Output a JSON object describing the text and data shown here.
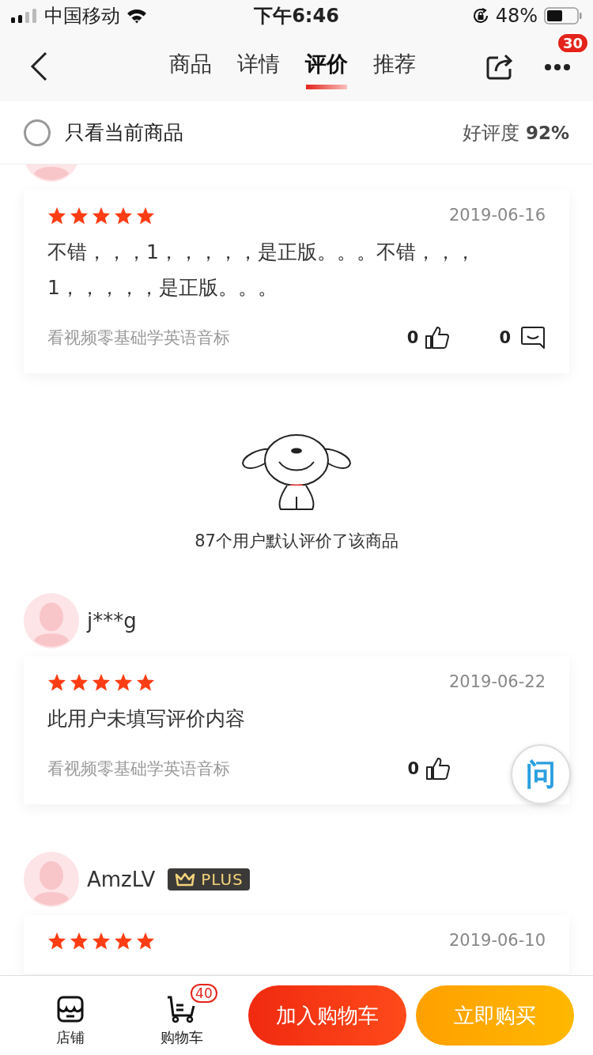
{
  "status_bar": {
    "carrier": "中国移动",
    "time": "下午6:46",
    "battery": "48%"
  },
  "nav": {
    "tabs": [
      {
        "label": "商品",
        "selected": false
      },
      {
        "label": "详情",
        "selected": false
      },
      {
        "label": "评价",
        "selected": true
      },
      {
        "label": "推荐",
        "selected": false
      }
    ],
    "more_badge": "30"
  },
  "filter": {
    "label": "只看当前商品",
    "checked": false,
    "rating_label": "好评度",
    "rating_value": "92%"
  },
  "reviews": [
    {
      "stars": 5,
      "date": "2019-06-16",
      "text": "不错，，，1，，，，，是正版。。。不错，，，1，，，，，是正版。。。",
      "product": "看视频零基础学英语音标",
      "likes": "0",
      "comments": "0"
    },
    {
      "user": "j***g",
      "stars": 5,
      "date": "2019-06-22",
      "text": "此用户未填写评价内容",
      "product": "看视频零基础学英语音标",
      "likes": "0"
    },
    {
      "user": "AmzLV",
      "plus": "PLUS",
      "stars": 5,
      "date": "2019-06-10"
    }
  ],
  "default_notice": "87个用户默认评价了该商品",
  "ask_button": {
    "label": "问"
  },
  "bottom_bar": {
    "shop": "店铺",
    "cart": "购物车",
    "cart_badge": "40",
    "add_to_cart": "加入购物车",
    "buy_now": "立即购买"
  }
}
